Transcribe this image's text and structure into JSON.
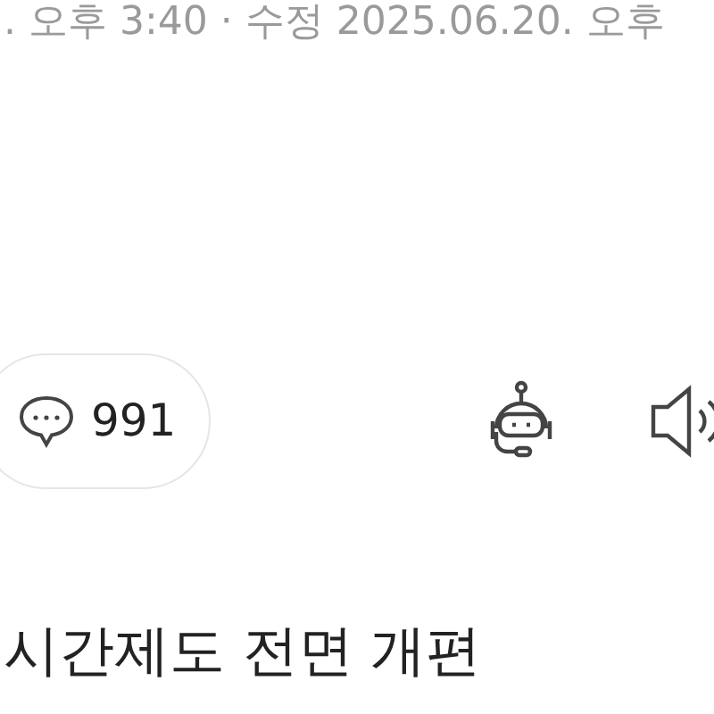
{
  "meta_line": ". 오후 3:40 · 수정 2025.06.20. 오후",
  "comment_button": {
    "count": "991"
  },
  "headline": "시간제도 전면 개편"
}
